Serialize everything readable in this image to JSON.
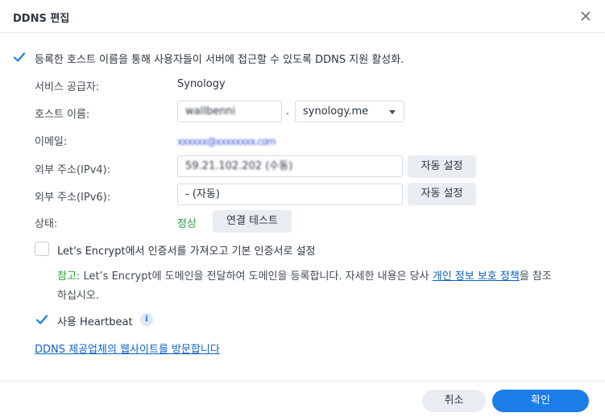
{
  "dialog": {
    "title": "DDNS 편집",
    "close_icon": "close-icon"
  },
  "enable": {
    "checked": true,
    "label": "등록한 호스트 이름을 통해 사용자들이 서버에 접근할 수 있도록 DDNS 지원 활성화."
  },
  "service_provider": {
    "label": "서비스 공급자:",
    "value": "Synology"
  },
  "hostname": {
    "label": "호스트 이름:",
    "value": "wallbenni",
    "separator": ".",
    "domain": "synology.me"
  },
  "email": {
    "label": "이메일:",
    "value": "xxxxxx@xxxxxxxx.com"
  },
  "ipv4": {
    "label": "외부 주소(IPv4):",
    "value": "59.21.102.202 (수동)",
    "button": "자동 설정"
  },
  "ipv6": {
    "label": "외부 주소(IPv6):",
    "value": "- (자동)",
    "button": "자동 설정"
  },
  "status": {
    "label": "상태:",
    "value": "정상",
    "value_color": "#26a537",
    "button": "연결 테스트"
  },
  "letsencrypt": {
    "checked": false,
    "label": "Let's Encrypt에서 인증서를 가져오고 기본 인증서로 설정"
  },
  "note": {
    "prefix": "참고:",
    "text1": " Let’s Encrypt에 도메인을 전달하여 도메인을 등록합니다. 자세한 내용은 당사 ",
    "link": "개인 정보 보호 정책",
    "text2": "을 참조",
    "line2": "하십시오."
  },
  "heartbeat": {
    "checked": true,
    "label": "사용 Heartbeat",
    "info_icon": "info-icon"
  },
  "provider_link": "DDNS 제공업체의 웹사이트를 방문합니다",
  "footer": {
    "cancel": "취소",
    "ok": "확인"
  },
  "colors": {
    "accent": "#1a7de8",
    "link": "#0b62c6",
    "status_ok": "#26a537"
  }
}
